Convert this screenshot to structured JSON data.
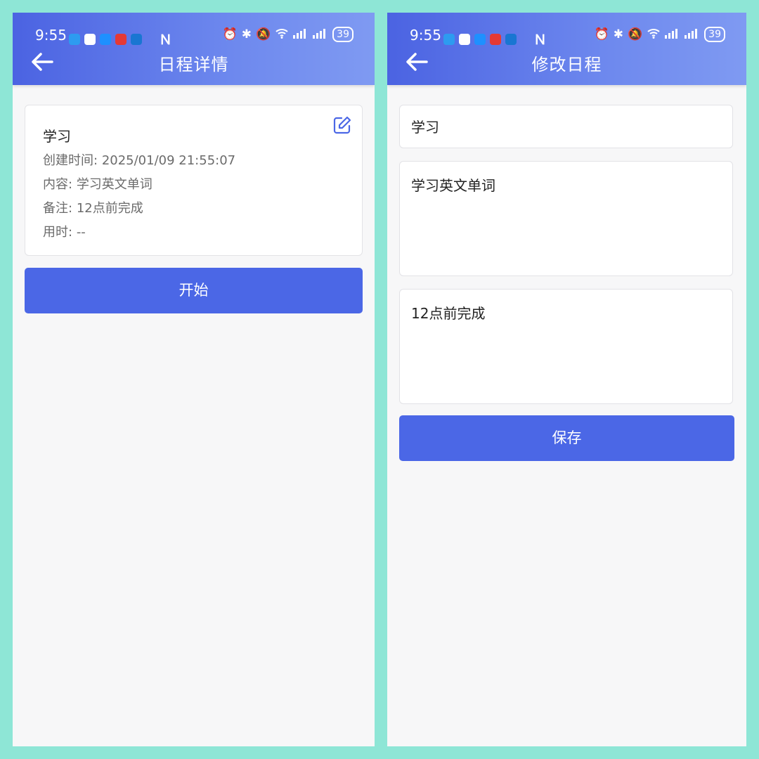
{
  "status_bar": {
    "time": "9:55",
    "battery": "39"
  },
  "detail_page": {
    "title": "日程详情",
    "card": {
      "name": "学习",
      "created_label": "创建时间:",
      "created_value": "2025/01/09 21:55:07",
      "content_label": "内容:",
      "content_value": "学习英文单词",
      "note_label": "备注:",
      "note_value": "12点前完成",
      "duration_label": "用时:",
      "duration_value": "--"
    },
    "start_button": "开始"
  },
  "edit_page": {
    "title": "修改日程",
    "title_field": "学习",
    "content_field": "学习英文单词",
    "note_field": "12点前完成",
    "save_button": "保存"
  },
  "colors": {
    "background": "#8ee6d6",
    "header_start": "#4b63e2",
    "header_end": "#7f9af2",
    "button": "#4b67e6"
  },
  "icons": [
    "back-arrow-icon",
    "edit-icon",
    "alarm-icon",
    "bluetooth-icon",
    "mute-icon",
    "wifi-icon",
    "signal-icon",
    "battery-icon",
    "nfc-icon"
  ]
}
